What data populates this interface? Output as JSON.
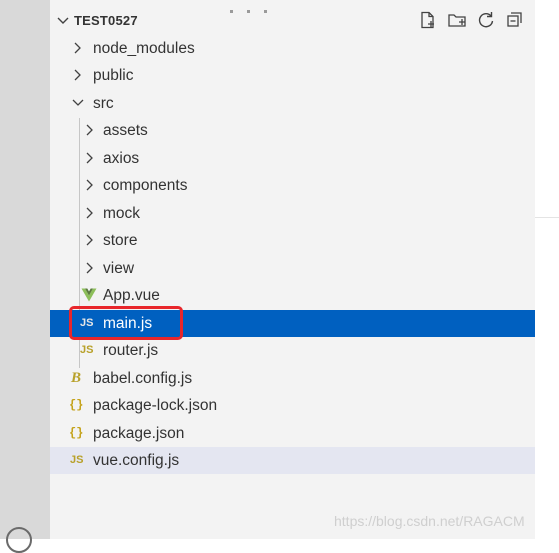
{
  "explorer": {
    "project_title": "TEST0527",
    "header_actions": [
      "new-file-icon",
      "new-folder-icon",
      "refresh-icon",
      "collapse-all-icon"
    ],
    "tree": [
      {
        "label": "node_modules",
        "kind": "folder",
        "expanded": false
      },
      {
        "label": "public",
        "kind": "folder",
        "expanded": false
      },
      {
        "label": "src",
        "kind": "folder",
        "expanded": true
      },
      {
        "label": "assets",
        "kind": "folder",
        "expanded": false
      },
      {
        "label": "axios",
        "kind": "folder",
        "expanded": false
      },
      {
        "label": "components",
        "kind": "folder",
        "expanded": false
      },
      {
        "label": "mock",
        "kind": "folder",
        "expanded": false
      },
      {
        "label": "store",
        "kind": "folder",
        "expanded": false
      },
      {
        "label": "view",
        "kind": "folder",
        "expanded": false
      },
      {
        "label": "App.vue",
        "kind": "vue"
      },
      {
        "label": "main.js",
        "kind": "js",
        "icon_text": "JS",
        "selected": true
      },
      {
        "label": "router.js",
        "kind": "js",
        "icon_text": "JS"
      },
      {
        "label": "babel.config.js",
        "kind": "babel",
        "icon_text": "B"
      },
      {
        "label": "package-lock.json",
        "kind": "json",
        "icon_text": "{}"
      },
      {
        "label": "package.json",
        "kind": "json",
        "icon_text": "{}"
      },
      {
        "label": "vue.config.js",
        "kind": "js",
        "icon_text": "JS",
        "focused": true
      }
    ]
  },
  "watermark": "https://blog.csdn.net/RAGACM",
  "colors": {
    "selection": "#0060c0",
    "highlight_box": "#e8262b",
    "vue_green": "#8dbf5a",
    "js_yellow": "#b8a12a"
  }
}
